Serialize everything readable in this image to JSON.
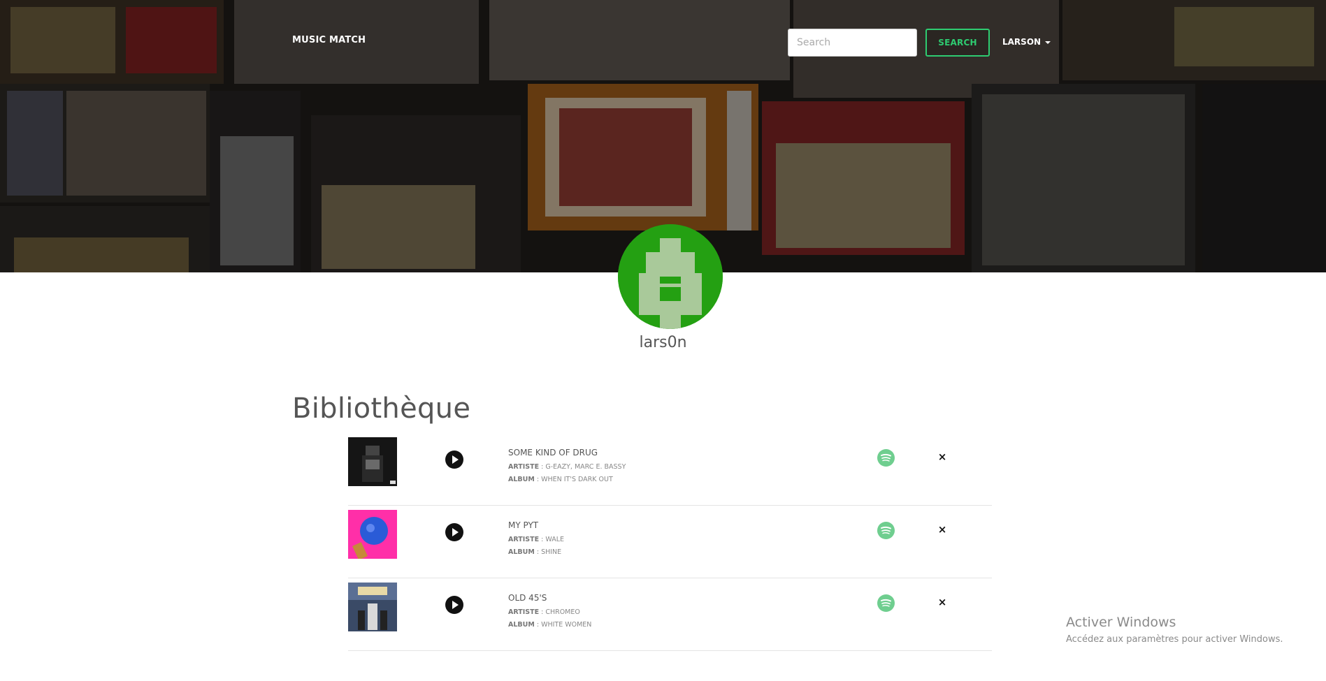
{
  "navbar": {
    "brand": "MUSIC MATCH",
    "search_placeholder": "Search",
    "search_button": "SEARCH",
    "user_menu": "LARSON"
  },
  "profile": {
    "username": "lars0n"
  },
  "library": {
    "title": "Bibliothèque",
    "artist_label": "ARTISTE",
    "album_label": "ALBUM",
    "tracks": [
      {
        "title": "SOME KIND OF DRUG",
        "artist": "G-EAZY, MARC E. BASSY",
        "album": "WHEN IT'S DARK OUT",
        "remove_label": "×"
      },
      {
        "title": "MY PYT",
        "artist": "WALE",
        "album": "SHINE",
        "remove_label": "×"
      },
      {
        "title": "OLD 45'S",
        "artist": "CHROMEO",
        "album": "WHITE WOMEN",
        "remove_label": "×"
      }
    ]
  },
  "watermark": {
    "title": "Activer Windows",
    "subtitle": "Accédez aux paramètres pour activer Windows."
  },
  "colors": {
    "accent_green": "#2ecc71",
    "spotify_green": "#6fce8f",
    "avatar_green": "#24a012",
    "avatar_light": "#a9c99a"
  }
}
